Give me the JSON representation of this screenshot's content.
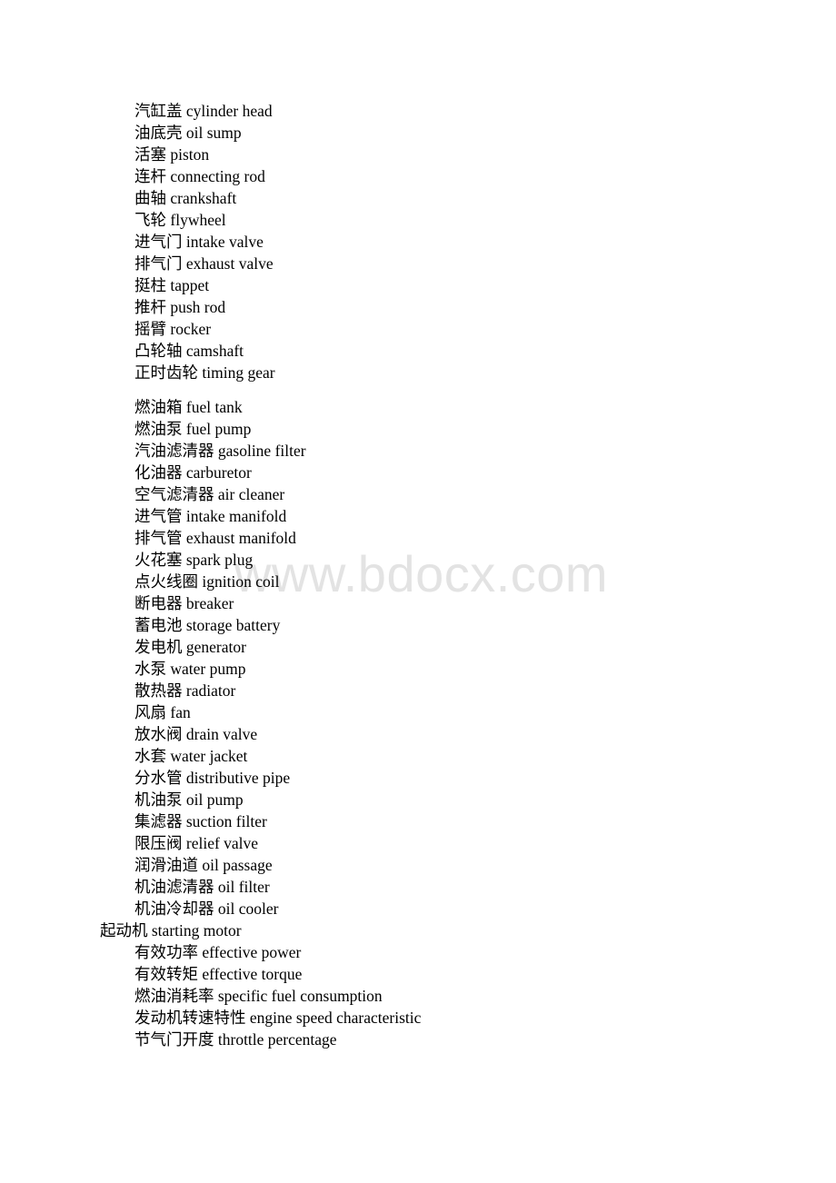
{
  "watermark": "www.bdocx.com",
  "section_1": [
    {
      "zh": "汽缸盖",
      "en": "cylinder head"
    },
    {
      "zh": "油底壳",
      "en": "oil sump"
    },
    {
      "zh": "活塞",
      "en": "piston"
    },
    {
      "zh": "连杆",
      "en": "connecting rod"
    },
    {
      "zh": "曲轴",
      "en": "crankshaft"
    },
    {
      "zh": "飞轮",
      "en": "flywheel"
    },
    {
      "zh": "进气门",
      "en": "intake valve"
    },
    {
      "zh": "排气门",
      "en": "exhaust valve"
    },
    {
      "zh": "挺柱",
      "en": "tappet"
    },
    {
      "zh": "推杆",
      "en": "push rod"
    },
    {
      "zh": "摇臂",
      "en": "rocker"
    },
    {
      "zh": "凸轮轴",
      "en": "camshaft"
    },
    {
      "zh": "正时齿轮",
      "en": "timing gear"
    }
  ],
  "section_2": [
    {
      "zh": "燃油箱",
      "en": "fuel tank"
    },
    {
      "zh": "燃油泵",
      "en": "fuel pump"
    },
    {
      "zh": "汽油滤清器",
      "en": "gasoline filter"
    },
    {
      "zh": "化油器",
      "en": "carburetor"
    },
    {
      "zh": "空气滤清器",
      "en": "air cleaner"
    },
    {
      "zh": "进气管",
      "en": "intake manifold"
    },
    {
      "zh": "排气管",
      "en": "exhaust manifold"
    },
    {
      "zh": "火花塞",
      "en": "spark plug"
    },
    {
      "zh": "点火线圈",
      "en": "ignition coil"
    },
    {
      "zh": "断电器",
      "en": "breaker"
    },
    {
      "zh": "蓄电池",
      "en": "storage battery"
    },
    {
      "zh": "发电机",
      "en": "generator"
    },
    {
      "zh": "水泵",
      "en": "water pump"
    },
    {
      "zh": "散热器",
      "en": "radiator"
    },
    {
      "zh": "风扇",
      "en": "fan"
    },
    {
      "zh": "放水阀",
      "en": "drain valve"
    },
    {
      "zh": "水套",
      "en": "water jacket"
    },
    {
      "zh": "分水管",
      "en": "distributive pipe"
    },
    {
      "zh": "机油泵",
      "en": "oil pump"
    },
    {
      "zh": "集滤器",
      "en": "suction filter"
    },
    {
      "zh": "限压阀",
      "en": "relief valve"
    },
    {
      "zh": "润滑油道",
      "en": "oil passage"
    },
    {
      "zh": "机油滤清器",
      "en": "oil filter"
    },
    {
      "zh": "机油冷却器",
      "en": "oil cooler"
    }
  ],
  "heading_item": {
    "zh": "起动机",
    "en": "starting motor"
  },
  "section_3": [
    {
      "zh": "有效功率",
      "en": "effective power"
    },
    {
      "zh": "有效转矩",
      "en": "effective torque"
    },
    {
      "zh": "燃油消耗率",
      "en": "specific fuel consumption"
    },
    {
      "zh": "发动机转速特性",
      "en": "engine speed characteristic"
    },
    {
      "zh": "节气门开度",
      "en": "throttle percentage"
    }
  ]
}
